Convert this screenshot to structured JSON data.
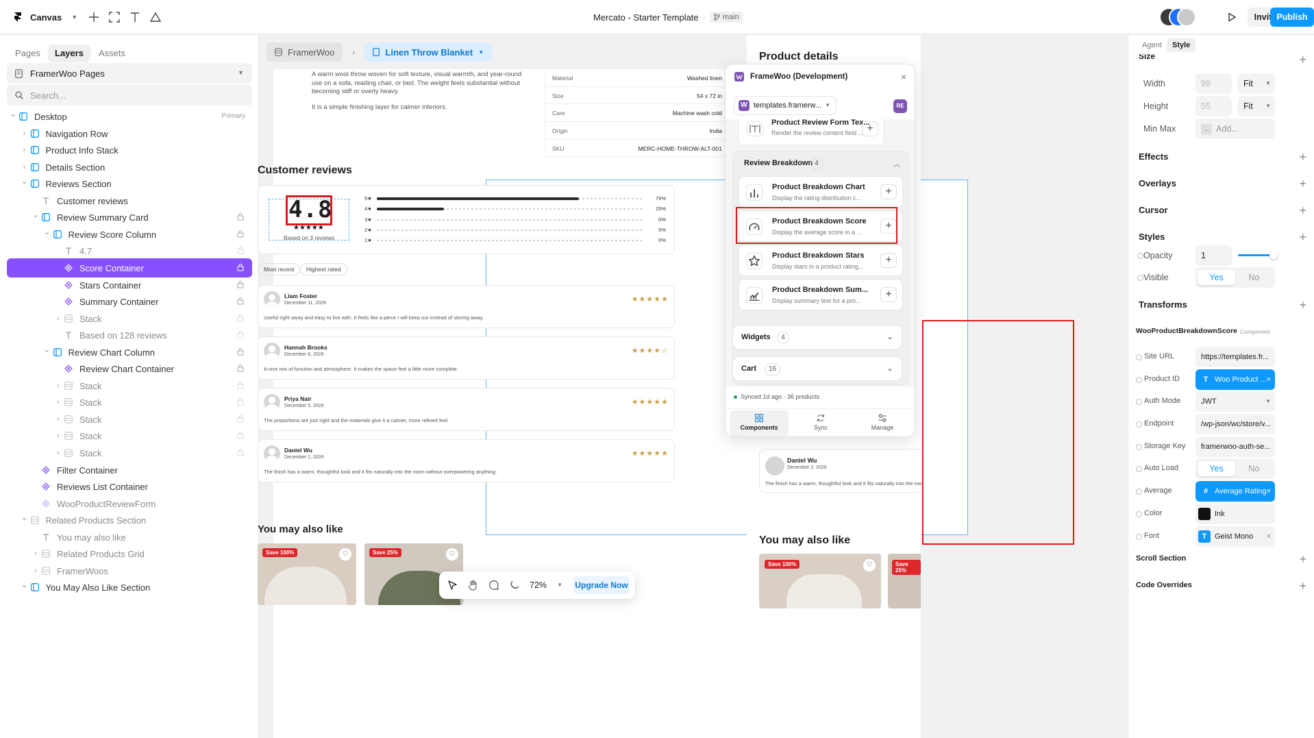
{
  "topbar": {
    "app_name": "Canvas",
    "project_title": "Mercato - Starter Template",
    "separator": "·",
    "branch": "main",
    "invite_label": "Invite",
    "publish_label": "Publish"
  },
  "left_panel": {
    "tabs": [
      "Pages",
      "Layers",
      "Assets"
    ],
    "active_tab": "Layers",
    "page_selector": "FramerWoo Pages",
    "search_placeholder": "Search...",
    "layers": [
      {
        "label": "Desktop",
        "tag": "Primary"
      },
      {
        "label": "Navigation Row"
      },
      {
        "label": "Product Info Stack"
      },
      {
        "label": "Details Section"
      },
      {
        "label": "Reviews Section"
      },
      {
        "label": "Customer reviews"
      },
      {
        "label": "Review Summary Card"
      },
      {
        "label": "Review Score Column"
      },
      {
        "label": "4.7"
      },
      {
        "label": "Score Container"
      },
      {
        "label": "Stars Container"
      },
      {
        "label": "Summary Container"
      },
      {
        "label": "Stack"
      },
      {
        "label": "Based on 128 reviews"
      },
      {
        "label": "Review Chart Column"
      },
      {
        "label": "Review Chart Container"
      },
      {
        "label": "Stack"
      },
      {
        "label": "Stack"
      },
      {
        "label": "Stack"
      },
      {
        "label": "Stack"
      },
      {
        "label": "Stack"
      },
      {
        "label": "Filter Container"
      },
      {
        "label": "Reviews List Container"
      },
      {
        "label": "WooProductReviewForm"
      },
      {
        "label": "Related Products Section"
      },
      {
        "label": "You may also like"
      },
      {
        "label": "Related Products Grid"
      },
      {
        "label": "FramerWoos"
      },
      {
        "label": "You May Also Like Section"
      }
    ]
  },
  "breadcrumb": {
    "root": "FramerWoo",
    "current": "Linen Throw Blanket"
  },
  "canvas": {
    "product_description_1": "A warm wool throw woven for soft texture, visual warmth, and year-round use on a sofa, reading chair, or bed. The weight feels substantial without becoming stiff or overly heavy.",
    "product_description_2": "It is a simple finishing layer for calmer interiors.",
    "details_heading": "Product details",
    "details": [
      {
        "k": "Material",
        "v": "Washed linen"
      },
      {
        "k": "Size",
        "v": "54 x 72 in"
      },
      {
        "k": "Care",
        "v": "Machine wash cold"
      },
      {
        "k": "Origin",
        "v": "India"
      },
      {
        "k": "SKU",
        "v": "MERC-HOME-THROW-ALT-001"
      }
    ],
    "reviews_heading": "Customer reviews",
    "score": "4.8",
    "score_stars": "★★★★★",
    "score_caption": "Based on 3 reviews",
    "rating_bars": [
      {
        "label": "5★",
        "fraction": 0.75,
        "pct": "75%"
      },
      {
        "label": "4★",
        "fraction": 0.25,
        "pct": "25%"
      },
      {
        "label": "3★",
        "fraction": 0,
        "pct": "0%"
      },
      {
        "label": "2★",
        "fraction": 0,
        "pct": "0%"
      },
      {
        "label": "1★",
        "fraction": 0,
        "pct": "0%"
      }
    ],
    "filters": [
      "Most recent",
      "Highest rated"
    ],
    "reviews": [
      {
        "name": "Liam Foster",
        "date": "December 11, 2026",
        "rating": "★★★★★",
        "text": "Useful right away and easy to live with. It feels like a piece I will keep out instead of storing away."
      },
      {
        "name": "Hannah Brooks",
        "date": "December 8, 2026",
        "rating": "★★★★☆",
        "text": "A nice mix of function and atmosphere. It makes the space feel a little more complete."
      },
      {
        "name": "Priya Nair",
        "date": "December 5, 2026",
        "rating": "★★★★★",
        "text": "The proportions are just right and the materials give it a calmer, more refined feel."
      },
      {
        "name": "Daniel Wu",
        "date": "December 2, 2026",
        "rating": "★★★★★",
        "text": "The finish has a warm, thoughtful look and it fits naturally into the room without overpowering anything."
      }
    ],
    "second_frame_review": {
      "name": "Daniel Wu",
      "date": "December 2, 2026",
      "text": "The finish has a warm, thoughtful look and it fits naturally into the room w"
    },
    "related_heading": "You may also like",
    "save_badges": [
      "Save 100%",
      "Save 25%"
    ],
    "toolbar": {
      "zoom": "72%",
      "upgrade_label": "Upgrade Now"
    }
  },
  "plugin": {
    "title": "FrameWoo (Development)",
    "site": "templates.framerw...",
    "user_badge": "RE",
    "top_item": {
      "title": "Product Review Form Tex...",
      "desc": "Render the review content field ..."
    },
    "group_title": "Review Breakdown",
    "group_count": "4",
    "components": [
      {
        "title": "Product Breakdown Chart",
        "desc": "Display the rating distribution c...",
        "icon": "bar-chart-icon"
      },
      {
        "title": "Product Breakdown Score",
        "desc": "Display the average score in a ...",
        "icon": "gauge-icon"
      },
      {
        "title": "Product Breakdown Stars",
        "desc": "Display stars in a product rating...",
        "icon": "star-icon"
      },
      {
        "title": "Product Breakdown Sum...",
        "desc": "Display summary text for a pro...",
        "icon": "trend-chart-icon"
      }
    ],
    "sections": [
      {
        "title": "Widgets",
        "count": "4"
      },
      {
        "title": "Cart",
        "count": "16"
      }
    ],
    "sync_status": "Synced 1d ago · 36 products",
    "tabs": [
      "Components",
      "Sync",
      "Manage"
    ]
  },
  "right_panel": {
    "tabs": [
      "Agent",
      "Style"
    ],
    "active_tab": "Style",
    "size_heading": "Size",
    "width_label": "Width",
    "width_value": "99",
    "width_mode": "Fit",
    "height_label": "Height",
    "height_value": "55",
    "height_mode": "Fit",
    "minmax_label": "Min Max",
    "minmax_value": "Add...",
    "sections": [
      "Effects",
      "Overlays",
      "Cursor",
      "Styles"
    ],
    "opacity_label": "Opacity",
    "opacity_value": "1",
    "opacity_level": 1,
    "visible_label": "Visible",
    "yes": "Yes",
    "no": "No",
    "transforms_heading": "Transforms",
    "component_name": "WooProductBreakdownScore",
    "component_tag": "Component",
    "props": [
      {
        "label": "Site URL",
        "value": "https://templates.fr..."
      },
      {
        "label": "Product ID",
        "value": "Woo Product ..."
      },
      {
        "label": "Auth Mode",
        "value": "JWT"
      },
      {
        "label": "Endpoint",
        "value": "/wp-json/wc/store/v..."
      },
      {
        "label": "Storage Key",
        "value": "framerwoo-auth-se..."
      },
      {
        "label": "Auto Load",
        "value": ""
      },
      {
        "label": "Average",
        "value": "Average Rating"
      },
      {
        "label": "Color",
        "value": "Ink"
      },
      {
        "label": "Font",
        "value": "Geist Mono"
      }
    ],
    "scroll_section": "Scroll Section",
    "code_overrides": "Code Overrides"
  },
  "colors": {
    "accent_blue": "#0d99ff",
    "selection_purple": "#8750ff",
    "highlight_red": "#e0191e",
    "star_gold": "#c8a24a"
  }
}
